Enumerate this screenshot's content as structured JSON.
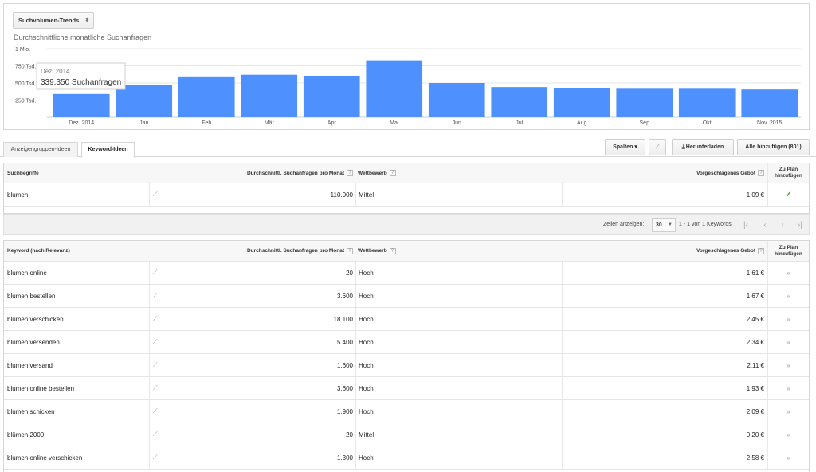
{
  "chart": {
    "select_label": "Suchvolumen-Trends",
    "subtitle": "Durchschnittliche monatliche Suchanfragen",
    "tooltip": {
      "title": "Dez. 2014",
      "value": "339.350 Suchanfragen"
    }
  },
  "chart_data": {
    "type": "bar",
    "title": "Durchschnittliche monatliche Suchanfragen",
    "categories": [
      "Dez. 2014",
      "Jan",
      "Feb",
      "Mär",
      "Apr",
      "Mai",
      "Jun",
      "Jul",
      "Aug",
      "Sep",
      "Okt",
      "Nov. 2015"
    ],
    "x_tick_labels": [
      "Dez. 2014",
      "Jan",
      "Feb",
      "Mär",
      "Apr",
      "Mai",
      "Jun",
      "Jul",
      "Aug",
      "Sep",
      "Okt",
      "Nov. 2015"
    ],
    "values": [
      339350,
      470000,
      595000,
      620000,
      605000,
      830000,
      500000,
      440000,
      430000,
      415000,
      415000,
      405000
    ],
    "y_ticks": [
      {
        "value": 250000,
        "label": "250 Tsd."
      },
      {
        "value": 500000,
        "label": "500 Tsd."
      },
      {
        "value": 750000,
        "label": "750 Tsd."
      },
      {
        "value": 1000000,
        "label": "1 Mio."
      }
    ],
    "ylim": [
      0,
      1000000
    ],
    "grid": true,
    "colors": {
      "bar": "#4d90fe",
      "grid": "#e6e6e6"
    }
  },
  "tabs": [
    {
      "label": "Anzeigengruppen-Ideen"
    },
    {
      "label": "Keyword-Ideen"
    }
  ],
  "toolbar": {
    "columns": "Spalten",
    "download": "Herunterladen",
    "add_all": "Alle hinzufügen (801)"
  },
  "search_table": {
    "headers": {
      "keyword": "Suchbegriffe",
      "volume": "Durchschnittl. Suchanfragen pro Monat",
      "competition": "Wettbewerb",
      "bid": "Vorgeschlagenes Gebot",
      "add": "Zu Plan hinzufügen"
    },
    "rows": [
      {
        "keyword": "blumen",
        "volume": "110.000",
        "competition": "Mittel",
        "bid": "1,09 €",
        "added": true
      }
    ]
  },
  "pager": {
    "rows_label": "Zeilen anzeigen:",
    "rows_value": "30",
    "range": "1 - 1 von 1 Keywords"
  },
  "ideas_table": {
    "headers": {
      "keyword": "Keyword (nach Relevanz)",
      "volume": "Durchschnittl. Suchanfragen pro Monat",
      "competition": "Wettbewerb",
      "bid": "Vorgeschlagenes Gebot",
      "add": "Zu Plan hinzufügen"
    },
    "rows": [
      {
        "keyword": "blumen online",
        "volume": "20",
        "competition": "Hoch",
        "bid": "1,61 €"
      },
      {
        "keyword": "blumen bestellen",
        "volume": "3.600",
        "competition": "Hoch",
        "bid": "1,67 €"
      },
      {
        "keyword": "blumen verschicken",
        "volume": "18.100",
        "competition": "Hoch",
        "bid": "2,45 €"
      },
      {
        "keyword": "blumen versenden",
        "volume": "5.400",
        "competition": "Hoch",
        "bid": "2,34 €"
      },
      {
        "keyword": "blumen versand",
        "volume": "1.600",
        "competition": "Hoch",
        "bid": "2,11 €"
      },
      {
        "keyword": "blumen online bestellen",
        "volume": "3.600",
        "competition": "Hoch",
        "bid": "1,93 €"
      },
      {
        "keyword": "blumen schicken",
        "volume": "1.900",
        "competition": "Hoch",
        "bid": "2,09 €"
      },
      {
        "keyword": "blümen 2000",
        "volume": "20",
        "competition": "Mittel",
        "bid": "0,20 €"
      },
      {
        "keyword": "blumen online verschicken",
        "volume": "1.300",
        "competition": "Hoch",
        "bid": "2,58 €"
      }
    ]
  }
}
